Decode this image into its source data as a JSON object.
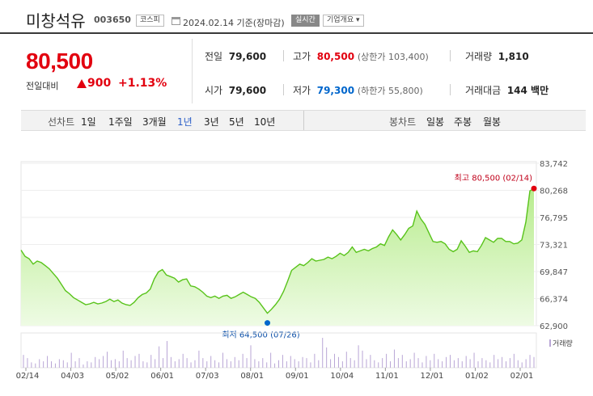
{
  "header": {
    "name": "미창석유",
    "code": "003650",
    "market": "코스피",
    "date": "2024.02.14 기준(장마감)",
    "realtime": "실시간",
    "company_menu": "기업개요 ▾"
  },
  "price": {
    "current": "80,500",
    "change_label": "전일대비",
    "change": "900",
    "change_pct": "+1.13%"
  },
  "stats": {
    "prev_label": "전일",
    "prev": "79,600",
    "high_label": "고가",
    "high": "80,500",
    "upper_limit": "(상한가 103,400)",
    "volume_label": "거래량",
    "volume": "1,810",
    "open_label": "시가",
    "open": "79,600",
    "low_label": "저가",
    "low": "79,300",
    "lower_limit": "(하한가 55,800)",
    "amount_label": "거래대금",
    "amount": "144 백만"
  },
  "toolbar": {
    "line_chart": "선차트",
    "periods": [
      "1일",
      "1주일",
      "3개월",
      "1년",
      "3년",
      "5년",
      "10년"
    ],
    "active_period": "1년",
    "candle_chart": "봉차트",
    "candles": [
      "일봉",
      "주봉",
      "월봉"
    ]
  },
  "chart_data": {
    "type": "area",
    "y_ticks": [
      "83,742",
      "80,268",
      "76,795",
      "73,321",
      "69,847",
      "66,374",
      "62,900"
    ],
    "ylim": [
      62900,
      83742
    ],
    "x_ticks": [
      "02/14",
      "04/03",
      "05/02",
      "06/01",
      "07/03",
      "08/01",
      "09/01",
      "10/04",
      "11/01",
      "12/01",
      "01/02",
      "02/01"
    ],
    "high_label": "최고 80,500 (02/14)",
    "low_label": "최저 64,500 (07/26)",
    "volume_label": "거래량",
    "series": [
      {
        "values": [
          72600,
          71800,
          71500,
          70800,
          71200,
          71000,
          70600,
          70200,
          69600,
          69000,
          68200,
          67400,
          67000,
          66500,
          66200,
          65900,
          65600,
          65700,
          65900,
          65700,
          65800,
          66000,
          66300,
          66000,
          66200,
          65800,
          65600,
          65500,
          65900,
          66500,
          66900,
          67100,
          67600,
          68900,
          69800,
          70100,
          69400,
          69200,
          69000,
          68500,
          68800,
          68900,
          68000,
          67900,
          67600,
          67200,
          66700,
          66500,
          66700,
          66400,
          66700,
          66800,
          66400,
          66600,
          66900,
          67200,
          66900,
          66600,
          66400,
          65900,
          65200,
          64500,
          65000,
          65600,
          66300,
          67300,
          68600,
          70000,
          70400,
          70800,
          70600,
          71000,
          71500,
          71200,
          71300,
          71400,
          71700,
          71500,
          71800,
          72200,
          71900,
          72300,
          73000,
          72300,
          72500,
          72700,
          72500,
          72800,
          73000,
          73400,
          73200,
          74300,
          75200,
          74600,
          73900,
          74600,
          75400,
          75700,
          77600,
          76600,
          75900,
          74800,
          73700,
          73600,
          73700,
          73400,
          72700,
          72400,
          72700,
          73800,
          73100,
          72300,
          72500,
          72400,
          73200,
          74200,
          73900,
          73600,
          74100,
          74100,
          73700,
          73700,
          73400,
          73500,
          73900,
          76200,
          80200,
          80500
        ]
      }
    ],
    "volume": [
      12,
      9,
      5,
      4,
      8,
      6,
      11,
      6,
      4,
      8,
      7,
      5,
      14,
      6,
      9,
      3,
      6,
      5,
      10,
      8,
      11,
      15,
      7,
      8,
      6,
      16,
      9,
      7,
      11,
      13,
      6,
      5,
      12,
      8,
      20,
      9,
      25,
      10,
      6,
      8,
      13,
      9,
      5,
      7,
      16,
      9,
      6,
      11,
      7,
      5,
      14,
      8,
      6,
      10,
      7,
      13,
      9,
      21,
      8,
      6,
      9,
      5,
      14,
      4,
      7,
      12,
      6,
      11,
      8,
      6,
      10,
      9,
      5,
      13,
      7,
      28,
      19,
      8,
      13,
      10,
      6,
      15,
      9,
      7,
      21,
      16,
      8,
      12,
      7,
      5,
      9,
      13,
      6,
      17,
      9,
      12,
      6,
      8,
      14,
      9,
      5,
      11,
      7,
      13,
      8,
      6,
      10,
      12,
      7,
      9,
      6,
      11,
      8,
      14,
      6,
      9,
      7,
      5,
      12,
      8,
      10,
      6,
      9,
      13,
      7,
      5,
      8,
      12,
      10
    ]
  }
}
